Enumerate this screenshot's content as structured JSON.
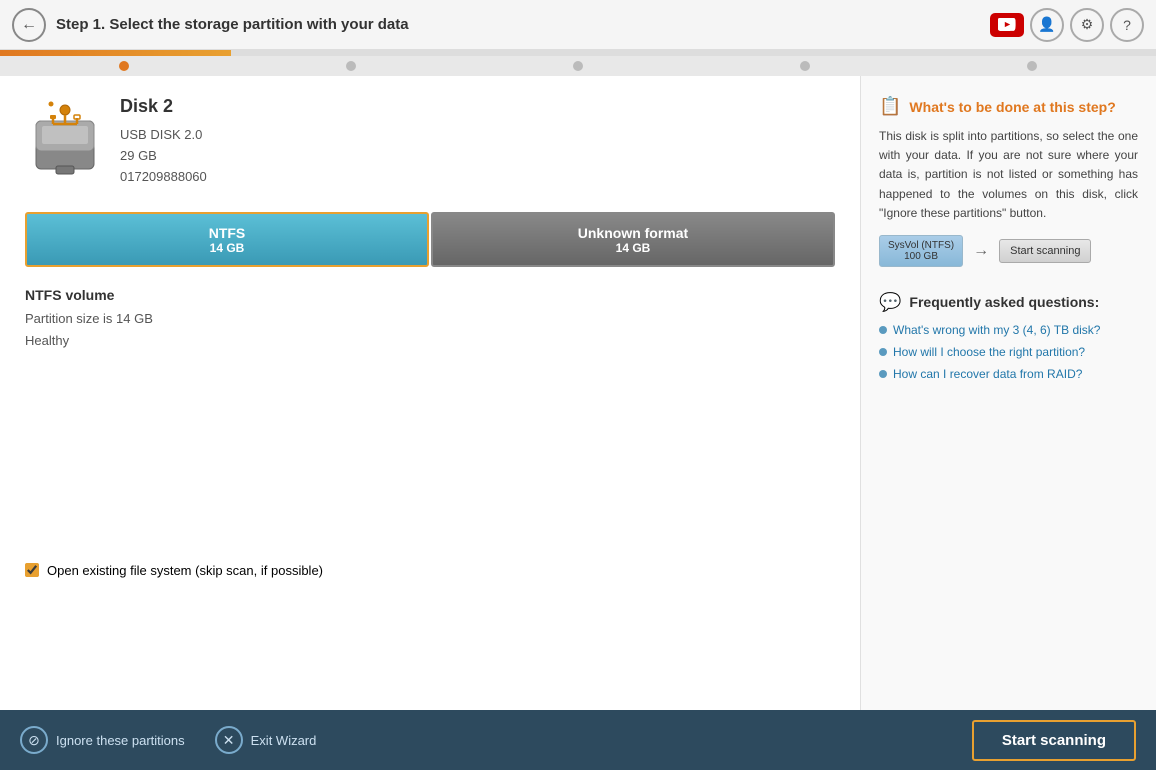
{
  "header": {
    "back_label": "←",
    "step_label": "Step 1.",
    "step_description": "Select the storage partition with your data"
  },
  "disk": {
    "title": "Disk 2",
    "type": "USB DISK 2.0",
    "size": "29 GB",
    "serial": "017209888060"
  },
  "partitions": [
    {
      "name": "NTFS",
      "size": "14 GB",
      "selected": true
    },
    {
      "name": "Unknown format",
      "size": "14 GB",
      "selected": false
    }
  ],
  "volume_info": {
    "title": "NTFS volume",
    "size_label": "Partition size is 14 GB",
    "status": "Healthy"
  },
  "checkbox": {
    "label": "Open existing file system ",
    "skip_label": "(skip scan, if possible)",
    "checked": true
  },
  "help": {
    "title": "What's to be done at this step?",
    "text": "This disk is split into partitions, so select the one with your data. If you are not sure where your data is, partition is not listed or something has happened to the volumes on this disk, click \"Ignore these partitions\" button.",
    "scan_vol_line1": "SysVol (NTFS)",
    "scan_vol_line2": "100 GB",
    "scan_btn_label": "Start scanning"
  },
  "faq": {
    "title": "Frequently asked questions:",
    "items": [
      "What's wrong with my 3 (4, 6) TB disk?",
      "How will I choose the right partition?",
      "How can I recover data from RAID?"
    ]
  },
  "footer": {
    "ignore_label": "Ignore these partitions",
    "exit_label": "Exit Wizard",
    "start_label": "Start scanning"
  }
}
